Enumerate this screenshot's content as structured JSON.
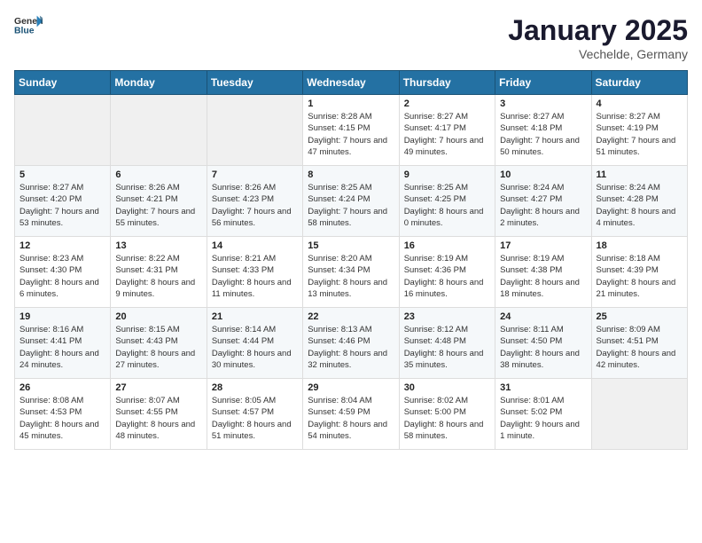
{
  "logo": {
    "text_general": "General",
    "text_blue": "Blue"
  },
  "header": {
    "title": "January 2025",
    "subtitle": "Vechelde, Germany"
  },
  "days_of_week": [
    "Sunday",
    "Monday",
    "Tuesday",
    "Wednesday",
    "Thursday",
    "Friday",
    "Saturday"
  ],
  "weeks": [
    [
      {
        "day": "",
        "info": ""
      },
      {
        "day": "",
        "info": ""
      },
      {
        "day": "",
        "info": ""
      },
      {
        "day": "1",
        "info": "Sunrise: 8:28 AM\nSunset: 4:15 PM\nDaylight: 7 hours and 47 minutes."
      },
      {
        "day": "2",
        "info": "Sunrise: 8:27 AM\nSunset: 4:17 PM\nDaylight: 7 hours and 49 minutes."
      },
      {
        "day": "3",
        "info": "Sunrise: 8:27 AM\nSunset: 4:18 PM\nDaylight: 7 hours and 50 minutes."
      },
      {
        "day": "4",
        "info": "Sunrise: 8:27 AM\nSunset: 4:19 PM\nDaylight: 7 hours and 51 minutes."
      }
    ],
    [
      {
        "day": "5",
        "info": "Sunrise: 8:27 AM\nSunset: 4:20 PM\nDaylight: 7 hours and 53 minutes."
      },
      {
        "day": "6",
        "info": "Sunrise: 8:26 AM\nSunset: 4:21 PM\nDaylight: 7 hours and 55 minutes."
      },
      {
        "day": "7",
        "info": "Sunrise: 8:26 AM\nSunset: 4:23 PM\nDaylight: 7 hours and 56 minutes."
      },
      {
        "day": "8",
        "info": "Sunrise: 8:25 AM\nSunset: 4:24 PM\nDaylight: 7 hours and 58 minutes."
      },
      {
        "day": "9",
        "info": "Sunrise: 8:25 AM\nSunset: 4:25 PM\nDaylight: 8 hours and 0 minutes."
      },
      {
        "day": "10",
        "info": "Sunrise: 8:24 AM\nSunset: 4:27 PM\nDaylight: 8 hours and 2 minutes."
      },
      {
        "day": "11",
        "info": "Sunrise: 8:24 AM\nSunset: 4:28 PM\nDaylight: 8 hours and 4 minutes."
      }
    ],
    [
      {
        "day": "12",
        "info": "Sunrise: 8:23 AM\nSunset: 4:30 PM\nDaylight: 8 hours and 6 minutes."
      },
      {
        "day": "13",
        "info": "Sunrise: 8:22 AM\nSunset: 4:31 PM\nDaylight: 8 hours and 9 minutes."
      },
      {
        "day": "14",
        "info": "Sunrise: 8:21 AM\nSunset: 4:33 PM\nDaylight: 8 hours and 11 minutes."
      },
      {
        "day": "15",
        "info": "Sunrise: 8:20 AM\nSunset: 4:34 PM\nDaylight: 8 hours and 13 minutes."
      },
      {
        "day": "16",
        "info": "Sunrise: 8:19 AM\nSunset: 4:36 PM\nDaylight: 8 hours and 16 minutes."
      },
      {
        "day": "17",
        "info": "Sunrise: 8:19 AM\nSunset: 4:38 PM\nDaylight: 8 hours and 18 minutes."
      },
      {
        "day": "18",
        "info": "Sunrise: 8:18 AM\nSunset: 4:39 PM\nDaylight: 8 hours and 21 minutes."
      }
    ],
    [
      {
        "day": "19",
        "info": "Sunrise: 8:16 AM\nSunset: 4:41 PM\nDaylight: 8 hours and 24 minutes."
      },
      {
        "day": "20",
        "info": "Sunrise: 8:15 AM\nSunset: 4:43 PM\nDaylight: 8 hours and 27 minutes."
      },
      {
        "day": "21",
        "info": "Sunrise: 8:14 AM\nSunset: 4:44 PM\nDaylight: 8 hours and 30 minutes."
      },
      {
        "day": "22",
        "info": "Sunrise: 8:13 AM\nSunset: 4:46 PM\nDaylight: 8 hours and 32 minutes."
      },
      {
        "day": "23",
        "info": "Sunrise: 8:12 AM\nSunset: 4:48 PM\nDaylight: 8 hours and 35 minutes."
      },
      {
        "day": "24",
        "info": "Sunrise: 8:11 AM\nSunset: 4:50 PM\nDaylight: 8 hours and 38 minutes."
      },
      {
        "day": "25",
        "info": "Sunrise: 8:09 AM\nSunset: 4:51 PM\nDaylight: 8 hours and 42 minutes."
      }
    ],
    [
      {
        "day": "26",
        "info": "Sunrise: 8:08 AM\nSunset: 4:53 PM\nDaylight: 8 hours and 45 minutes."
      },
      {
        "day": "27",
        "info": "Sunrise: 8:07 AM\nSunset: 4:55 PM\nDaylight: 8 hours and 48 minutes."
      },
      {
        "day": "28",
        "info": "Sunrise: 8:05 AM\nSunset: 4:57 PM\nDaylight: 8 hours and 51 minutes."
      },
      {
        "day": "29",
        "info": "Sunrise: 8:04 AM\nSunset: 4:59 PM\nDaylight: 8 hours and 54 minutes."
      },
      {
        "day": "30",
        "info": "Sunrise: 8:02 AM\nSunset: 5:00 PM\nDaylight: 8 hours and 58 minutes."
      },
      {
        "day": "31",
        "info": "Sunrise: 8:01 AM\nSunset: 5:02 PM\nDaylight: 9 hours and 1 minute."
      },
      {
        "day": "",
        "info": ""
      }
    ]
  ]
}
